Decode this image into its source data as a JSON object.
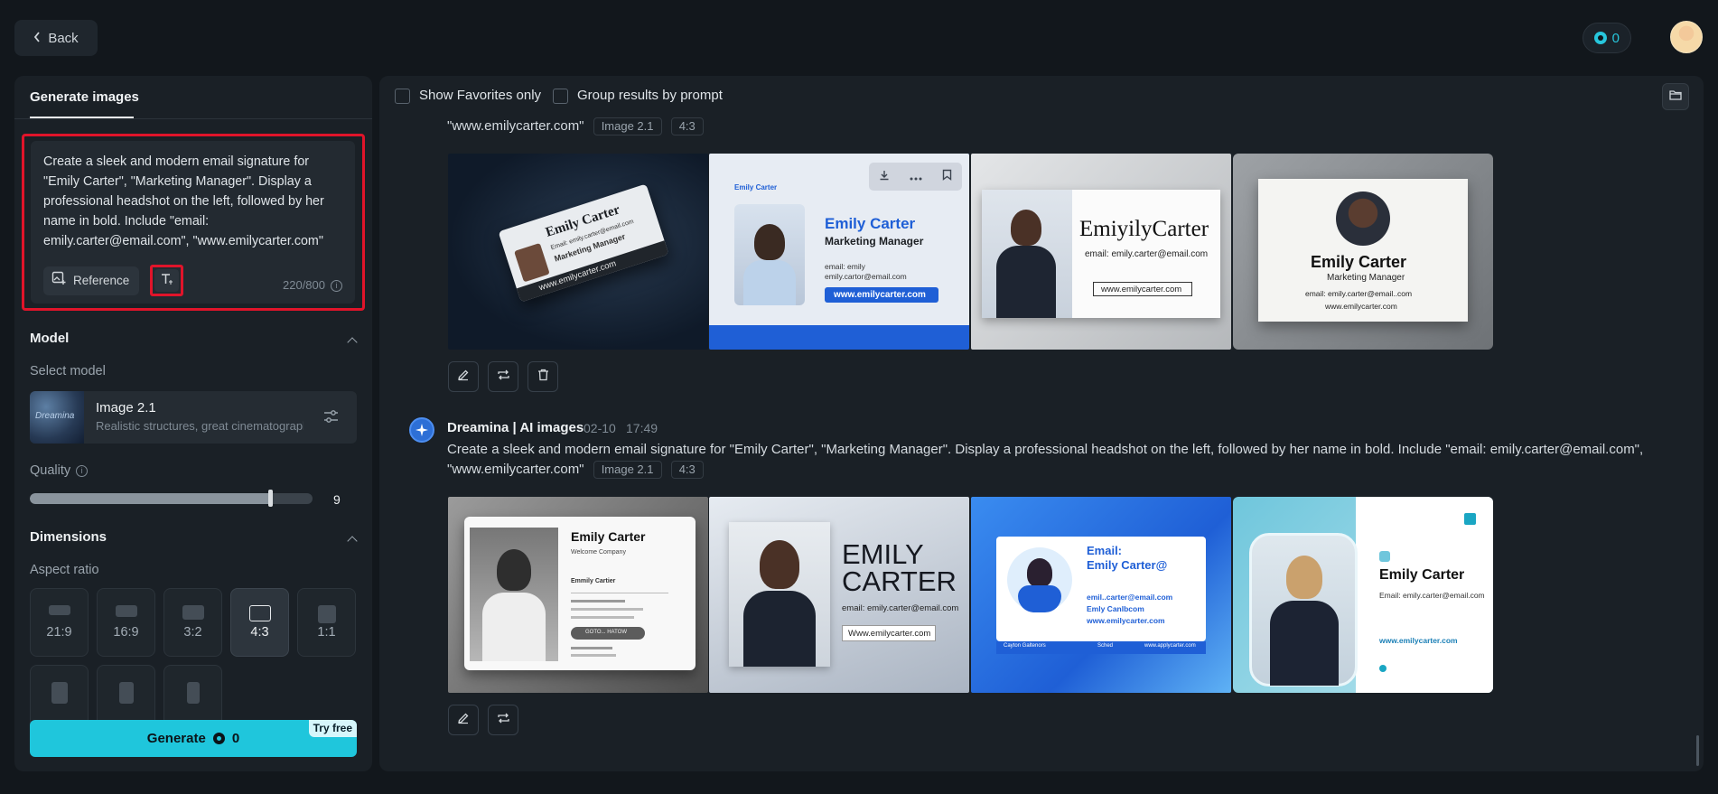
{
  "topbar": {
    "back_label": "Back",
    "credits": "0"
  },
  "left": {
    "tab_label": "Generate images",
    "prompt": "Create a sleek and modern email signature for \"Emily Carter\", \"Marketing Manager\". Display a professional headshot on the left, followed by her name in bold. Include \"email: emily.carter@email.com\", \"www.emilycarter.com\"",
    "reference_label": "Reference",
    "char_count": "220/800",
    "model_section": "Model",
    "select_model_label": "Select model",
    "model_name": "Image 2.1",
    "model_desc": "Realistic structures, great cinematography",
    "model_thumb_text": "Dreamina",
    "quality_label": "Quality",
    "quality_value": "9",
    "quality_level": 0.85,
    "dimensions_section": "Dimensions",
    "aspect_label": "Aspect ratio",
    "aspect_ratios": [
      "21:9",
      "16:9",
      "3:2",
      "4:3",
      "1:1"
    ],
    "selected_ratio": "4:3",
    "generate_label": "Generate",
    "generate_cost": "0",
    "try_free": "Try free"
  },
  "right": {
    "show_favorites": "Show Favorites only",
    "group_by_prompt": "Group results by prompt",
    "group1": {
      "prompt_tail": "\"www.emilycarter.com\"",
      "model_tag": "Image 2.1",
      "ratio_tag": "4:3",
      "cards": {
        "c1_name": "Emily Carter",
        "c1_line1": "Email: emily.carter@email.com",
        "c1_line2": "Marketing Manager",
        "c1_web": "www.emilycarter.com",
        "c2_brand": "Emily Carter",
        "c2_name": "Emily Carter",
        "c2_title": "Marketing Manager",
        "c2_email1": "email: emily",
        "c2_email2": "emily.cartor@email.com",
        "c2_web": "www.emilycarter.com",
        "c3_name": "EmiyilyCarter",
        "c3_email": "email: emily.carter@email.com",
        "c3_web": "www.emilycarter.com",
        "c4_name": "Emily Carter",
        "c4_title": "Marketing Manager",
        "c4_email": "email: emily.carter@email..com",
        "c4_web": "www.emilycarter.com"
      }
    },
    "group2": {
      "sender": "Dreamina | AI images",
      "date": "02-10",
      "time": "17:49",
      "prompt_line1": "Create a sleek and modern email signature for \"Emily Carter\", \"Marketing Manager\". Display a professional headshot on the left, followed by her name in bold. Include \"email: emily.carter@email.com\",",
      "prompt_line2": "\"www.emilycarter.com\"",
      "model_tag": "Image 2.1",
      "ratio_tag": "4:3",
      "cards": {
        "d1_name": "Emily Carter",
        "d1_sub": "Welcome Company",
        "d1_line": "Emmily Cartier",
        "d1_btn": "GOTO... HATOW",
        "d2_name1": "EMILY",
        "d2_name2": "CARTER",
        "d2_email": "email: emily.carter@email.com",
        "d2_web": "Www.emilycarter.com",
        "d3_head1": "Email:",
        "d3_head2": "Emily Carter@",
        "d3_l1": "emil..carter@email.com",
        "d3_l2": "Emly Canlbcom",
        "d3_l3": "www.emilycarter.com",
        "d3_f1": "Cayton Galtenors",
        "d3_f2": "Sched",
        "d3_f3": "www.applycarter.com",
        "d4_name": "Emily Carter",
        "d4_email": "Email: emily.carter@email.com",
        "d4_web": "www.emilycarter.com"
      }
    }
  }
}
